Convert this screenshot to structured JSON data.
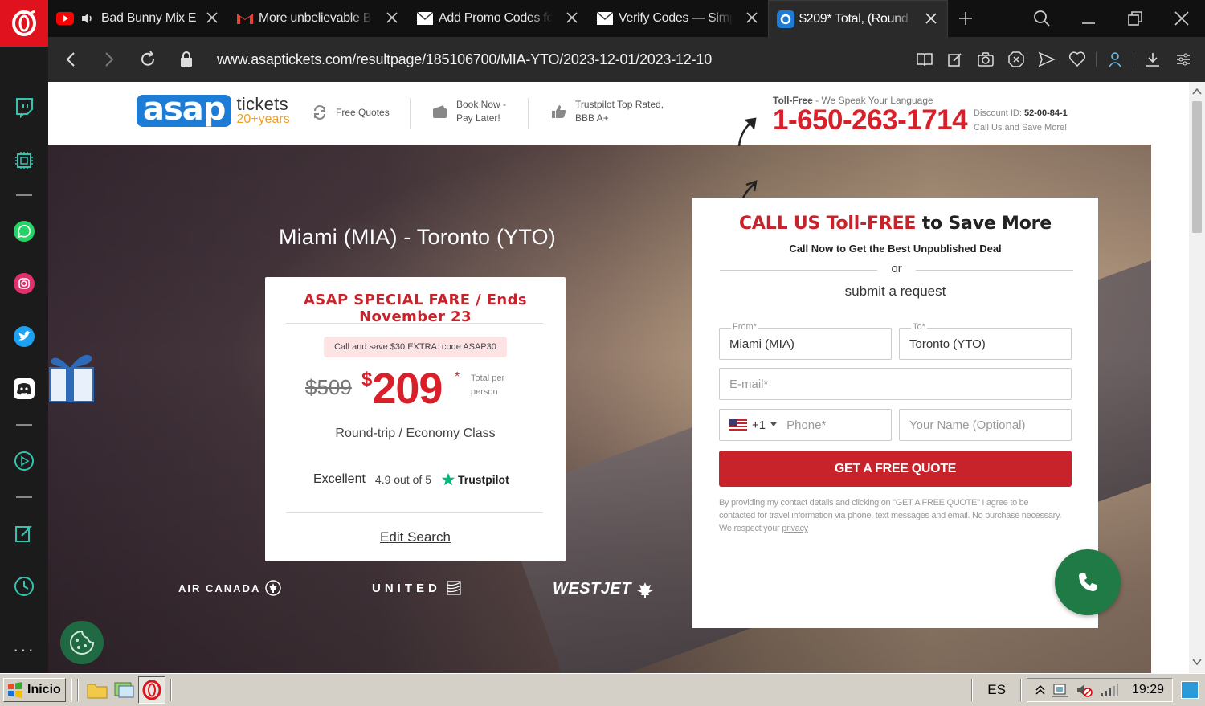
{
  "browser": {
    "tabs": [
      {
        "title": "Bad Bunny Mix E",
        "icon": "youtube-icon",
        "audio": true,
        "active": false
      },
      {
        "title": "More unbelievable B",
        "icon": "gmail-icon",
        "active": false
      },
      {
        "title": "Add Promo Codes fo",
        "icon": "mail-envelope-icon",
        "active": false
      },
      {
        "title": "Verify Codes — Simp",
        "icon": "mail-envelope-icon",
        "active": false
      },
      {
        "title": "$209* Total, (Round",
        "icon": "asap-tickets-favicon",
        "active": true
      }
    ],
    "url": "www.asaptickets.com/resultpage/185106700/MIA-YTO/2023-12-01/2023-12-10"
  },
  "site": {
    "header": {
      "logo_main": "asap",
      "logo_tickets": "tickets",
      "logo_years": "20+years",
      "feature_quotes": "Free Quotes",
      "feature_book_l1": "Book Now -",
      "feature_book_l2": "Pay Later!",
      "feature_trust_l1": "Trustpilot Top Rated,",
      "feature_trust_l2": "BBB A+",
      "toll_free_label": "Toll-Free",
      "toll_free_sub": " - We Speak Your Language",
      "phone": "1-650-263-1714",
      "discount_label": "Discount ID: ",
      "discount_id": "52-00-84-1",
      "discount_sub": "Call Us and Save More!"
    },
    "route_title": "Miami (MIA) - Toronto (YTO)",
    "fare_card": {
      "special": "ASAP SPECIAL FARE / Ends November 23",
      "promo": "Call and save $30 EXTRA: code ASAP30",
      "old_price": "$509",
      "currency": "$",
      "new_price": "209",
      "star": "*",
      "price_note": "Total per person",
      "trip_type": "Round-trip / Economy Class",
      "rating_word": "Excellent",
      "rating_score": "4.9 out of 5",
      "trustpilot": "Trustpilot",
      "edit_search": "Edit Search"
    },
    "airlines": {
      "air_canada": "AIR CANADA",
      "united": "UNITED",
      "westjet": "WESTJET"
    },
    "request": {
      "title_red": "CALL US Toll-FREE",
      "title_rest": " to Save More",
      "subtitle": "Call Now to Get the Best Unpublished Deal",
      "or": "or",
      "submit": "submit a request",
      "from_label": "From*",
      "from_value": "Miami (MIA)",
      "to_label": "To*",
      "to_value": "Toronto (YTO)",
      "email_placeholder": "E-mail*",
      "phone_code": "+1",
      "phone_placeholder": "Phone*",
      "name_placeholder": "Your Name (Optional)",
      "button": "GET A FREE QUOTE",
      "disclaimer": "By providing my contact details and clicking on \"GET A FREE QUOTE\" I agree to be contacted for travel information via phone, text messages and email. No purchase necessary. We respect your ",
      "privacy_link": "privacy"
    }
  },
  "taskbar": {
    "start": "Inicio",
    "language": "ES",
    "clock": "19:29"
  },
  "colors": {
    "brand_red": "#d9202a",
    "brand_blue": "#1c7cd6",
    "opera_red": "#e0121d",
    "fab_green": "#1f7a45"
  }
}
